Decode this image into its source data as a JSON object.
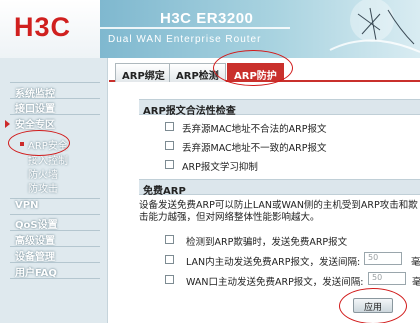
{
  "header": {
    "brand": "H3C",
    "model_prefix": "H3C",
    "model": "ER3200",
    "subtitle": "Dual WAN Enterprise Router"
  },
  "sidebar": {
    "items": [
      {
        "label": "系统监控"
      },
      {
        "label": "接口设置"
      },
      {
        "label": "安全专区",
        "expanded": true
      },
      {
        "label": "VPN"
      },
      {
        "label": "QoS设置"
      },
      {
        "label": "高级设置"
      },
      {
        "label": "设备管理"
      },
      {
        "label": "用户FAQ"
      }
    ],
    "sub_items": [
      {
        "label": "ARP安全",
        "selected": true
      },
      {
        "label": "接入控制"
      },
      {
        "label": "防火墙"
      },
      {
        "label": "防攻击"
      }
    ]
  },
  "tabs": [
    {
      "label": "ARP绑定"
    },
    {
      "label": "ARP检测"
    },
    {
      "label": "ARP防护",
      "active": true
    }
  ],
  "section1": {
    "title": "ARP报文合法性检查",
    "options": [
      {
        "label": "丢弃源MAC地址不合法的ARP报文",
        "checked": false
      },
      {
        "label": "丢弃源MAC地址不一致的ARP报文",
        "checked": false
      },
      {
        "label": "ARP报文学习抑制",
        "checked": false
      }
    ]
  },
  "section2": {
    "title": "免费ARP",
    "description_line1": "设备发送免费ARP可以防止LAN或WAN侧的主机受到ARP攻击和欺",
    "description_line2": "击能力越强，但对网络整体性能影响越大。",
    "options": [
      {
        "label": "检测到ARP欺骗时，发送免费ARP报文",
        "checked": false
      },
      {
        "label": "LAN内主动发送免费ARP报文，发送间隔:",
        "checked": false,
        "value": "50",
        "unit": "毫"
      },
      {
        "label": "WAN口主动发送免费ARP报文，发送间隔:",
        "checked": false,
        "value": "50",
        "unit": "毫"
      }
    ]
  },
  "apply_label": "应用",
  "colors": {
    "accent": "#c9302c",
    "header_band": "#7fb8cf",
    "sidebar_bg": "#dfe9ee",
    "annotation": "#d11b1b"
  }
}
